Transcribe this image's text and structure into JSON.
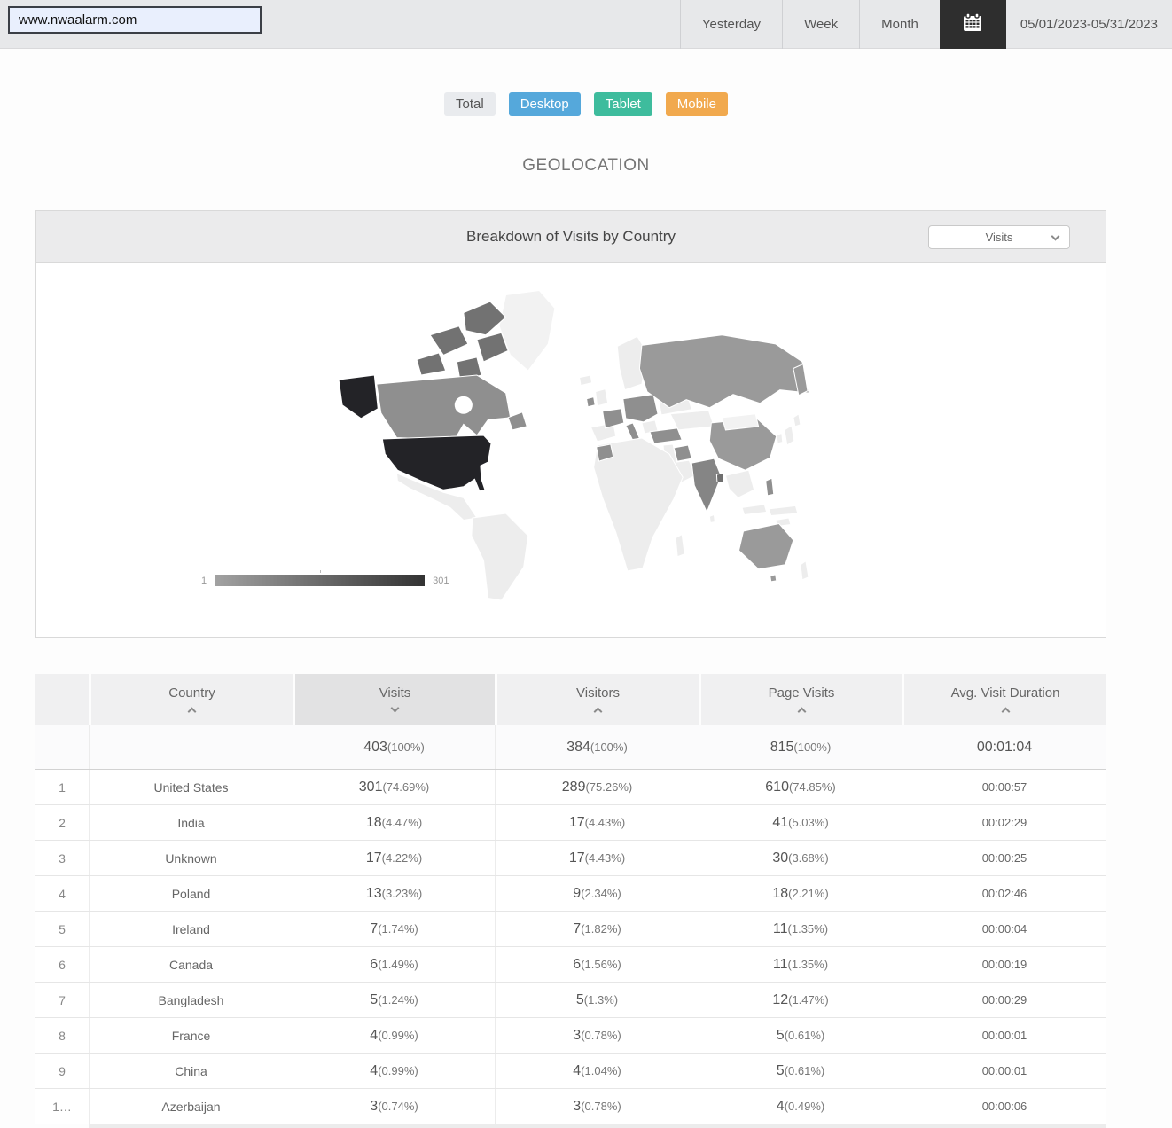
{
  "topbar": {
    "url_value": "www.nwaalarm.com",
    "yesterday_label": "Yesterday",
    "week_label": "Week",
    "month_label": "Month",
    "date_range": "05/01/2023-05/31/2023",
    "calendar_button_color": "#2e2e2e"
  },
  "filters": {
    "total": {
      "label": "Total",
      "color": "#e9ebee"
    },
    "desktop": {
      "label": "Desktop",
      "color": "#55a8db"
    },
    "tablet": {
      "label": "Tablet",
      "color": "#3ebc9d"
    },
    "mobile": {
      "label": "Mobile",
      "color": "#f1a94e"
    }
  },
  "geolocation_title": "GEOLOCATION",
  "panel": {
    "title": "Breakdown of Visits by Country",
    "metric_dropdown_value": "Visits",
    "legend": {
      "min": "1",
      "max": "301",
      "start_color": "#a2a2a2",
      "end_color": "#333333"
    },
    "map_colors": {
      "highest": "#232327",
      "medium": "#8f8f8f",
      "low": "#ededed"
    }
  },
  "table": {
    "columns": [
      {
        "label": "Country",
        "sort": "asc",
        "active": "false"
      },
      {
        "label": "Visits",
        "sort": "desc",
        "active": "true"
      },
      {
        "label": "Visitors",
        "sort": "asc",
        "active": "false"
      },
      {
        "label": "Page Visits",
        "sort": "asc",
        "active": "false"
      },
      {
        "label": "Avg. Visit Duration",
        "sort": "asc",
        "active": "false"
      }
    ],
    "totals": {
      "visits": "403",
      "visits_pct": "(100%)",
      "visitors": "384",
      "visitors_pct": "(100%)",
      "pages": "815",
      "pages_pct": "(100%)",
      "duration": "00:01:04"
    },
    "rows": [
      {
        "rank": "1",
        "country": "United States",
        "visits": "301",
        "visits_pct": "(74.69%)",
        "visitors": "289",
        "visitors_pct": "(75.26%)",
        "pages": "610",
        "pages_pct": "(74.85%)",
        "duration": "00:00:57"
      },
      {
        "rank": "2",
        "country": "India",
        "visits": "18",
        "visits_pct": "(4.47%)",
        "visitors": "17",
        "visitors_pct": "(4.43%)",
        "pages": "41",
        "pages_pct": "(5.03%)",
        "duration": "00:02:29"
      },
      {
        "rank": "3",
        "country": "Unknown",
        "visits": "17",
        "visits_pct": "(4.22%)",
        "visitors": "17",
        "visitors_pct": "(4.43%)",
        "pages": "30",
        "pages_pct": "(3.68%)",
        "duration": "00:00:25"
      },
      {
        "rank": "4",
        "country": "Poland",
        "visits": "13",
        "visits_pct": "(3.23%)",
        "visitors": "9",
        "visitors_pct": "(2.34%)",
        "pages": "18",
        "pages_pct": "(2.21%)",
        "duration": "00:02:46"
      },
      {
        "rank": "5",
        "country": "Ireland",
        "visits": "7",
        "visits_pct": "(1.74%)",
        "visitors": "7",
        "visitors_pct": "(1.82%)",
        "pages": "11",
        "pages_pct": "(1.35%)",
        "duration": "00:00:04"
      },
      {
        "rank": "6",
        "country": "Canada",
        "visits": "6",
        "visits_pct": "(1.49%)",
        "visitors": "6",
        "visitors_pct": "(1.56%)",
        "pages": "11",
        "pages_pct": "(1.35%)",
        "duration": "00:00:19"
      },
      {
        "rank": "7",
        "country": "Bangladesh",
        "visits": "5",
        "visits_pct": "(1.24%)",
        "visitors": "5",
        "visitors_pct": "(1.3%)",
        "pages": "12",
        "pages_pct": "(1.47%)",
        "duration": "00:00:29"
      },
      {
        "rank": "8",
        "country": "France",
        "visits": "4",
        "visits_pct": "(0.99%)",
        "visitors": "3",
        "visitors_pct": "(0.78%)",
        "pages": "5",
        "pages_pct": "(0.61%)",
        "duration": "00:00:01"
      },
      {
        "rank": "9",
        "country": "China",
        "visits": "4",
        "visits_pct": "(0.99%)",
        "visitors": "4",
        "visitors_pct": "(1.04%)",
        "pages": "5",
        "pages_pct": "(0.61%)",
        "duration": "00:00:01"
      },
      {
        "rank": "1…",
        "country": "Azerbaijan",
        "visits": "3",
        "visits_pct": "(0.74%)",
        "visitors": "3",
        "visitors_pct": "(0.78%)",
        "pages": "4",
        "pages_pct": "(0.49%)",
        "duration": "00:00:06"
      }
    ]
  }
}
